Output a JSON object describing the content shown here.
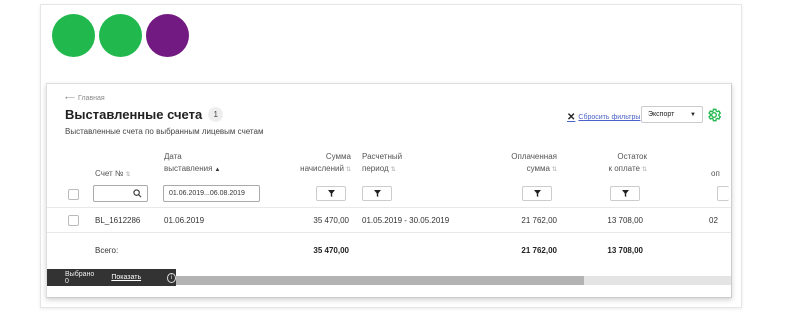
{
  "brand": {
    "dot_colors": [
      "#21b94e",
      "#21b94e",
      "#731982"
    ]
  },
  "breadcrumb": {
    "arrow": "⟵",
    "label": "Главная"
  },
  "page": {
    "title": "Выставленные счета",
    "count": "1",
    "subtitle": "Выставленные счета по выбранным лицевым счетам"
  },
  "toolbar": {
    "reset_filters": "Сбросить фильтры",
    "export_label": "Экспорт",
    "accent_color": "#21b94e"
  },
  "table": {
    "headers": {
      "invoice_no": "Счет №",
      "issue_date_1": "Дата",
      "issue_date_2": "выставления",
      "amount_1": "Сумма",
      "amount_2": "начислений",
      "period_1": "Расчетный",
      "period_2": "период",
      "paid_1": "Оплаченная",
      "paid_2": "сумма",
      "balance_1": "Остаток",
      "balance_2": "к оплате",
      "extra": "оп"
    },
    "filters": {
      "search_value": "",
      "date_range": "01.06.2019...06.08.2019"
    },
    "rows": [
      {
        "invoice_no": "BL_1612286",
        "issue_date": "01.06.2019",
        "amount": "35 470,00",
        "period": "01.05.2019 - 30.05.2019",
        "paid": "21 762,00",
        "balance": "13 708,00",
        "extra": "02"
      }
    ],
    "totals": {
      "label": "Всего:",
      "amount": "35 470,00",
      "paid": "21 762,00",
      "balance": "13 708,00"
    }
  },
  "selection_bar": {
    "selected": "Выбрано 0",
    "show": "Показать",
    "info_icon": "i"
  }
}
